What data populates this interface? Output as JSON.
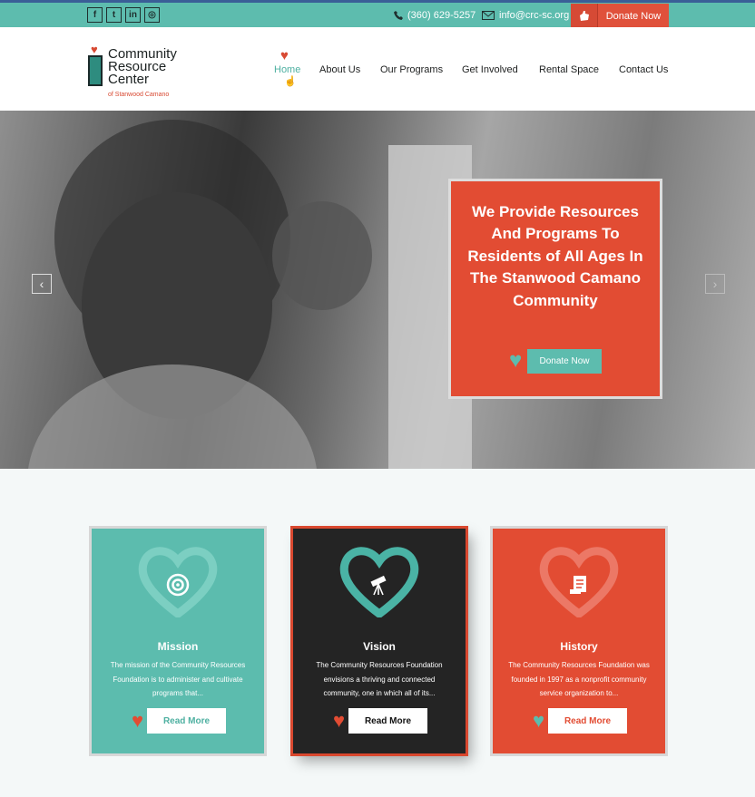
{
  "topbar": {
    "social": [
      {
        "icon": "facebook-icon",
        "glyph": "f"
      },
      {
        "icon": "twitter-icon",
        "glyph": "t"
      },
      {
        "icon": "linkedin-icon",
        "glyph": "in"
      },
      {
        "icon": "instagram-icon",
        "glyph": "◎"
      }
    ],
    "phone": "(360) 629-5257",
    "email": "info@crc-sc.org",
    "donate_label": "Donate Now"
  },
  "logo": {
    "line1": "Community",
    "line2": "Resource",
    "line3": "Center",
    "sub": "of Stanwood Camano"
  },
  "nav": {
    "items": [
      "Home",
      "About Us",
      "Our Programs",
      "Get Involved",
      "Rental Space",
      "Contact Us"
    ],
    "active_index": 0
  },
  "hero": {
    "title": "We Provide Resources And Programs To Residents of All Ages In The Stanwood Camano Community",
    "button_label": "Donate Now",
    "prev_arrow": "‹",
    "next_arrow": "›"
  },
  "cards": [
    {
      "title": "Mission",
      "desc": "The mission of the Community Resources Foundation is to administer and cultivate programs that...",
      "button": "Read More",
      "icon": "target-icon",
      "color": "#5cbcae"
    },
    {
      "title": "Vision",
      "desc": "The Community Resources Foundation envisions a thriving and connected community, one in which all of its...",
      "button": "Read More",
      "icon": "telescope-icon",
      "color": "#242424"
    },
    {
      "title": "History",
      "desc": "The Community Resources Foundation was founded in 1997 as a nonprofit community service organization to...",
      "button": "Read More",
      "icon": "scroll-icon",
      "color": "#e24c33"
    }
  ],
  "colors": {
    "teal": "#5dbcae",
    "red": "#e24c33",
    "dark": "#242424",
    "topbar_border": "#3a5e97"
  }
}
